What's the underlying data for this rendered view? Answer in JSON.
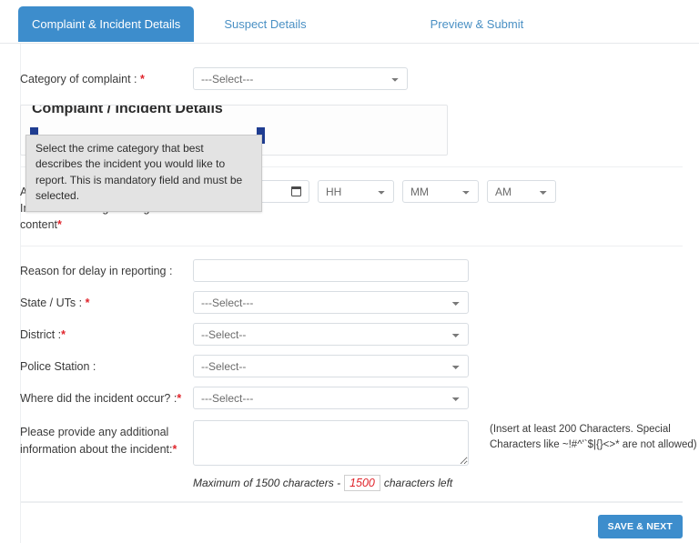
{
  "theme": {
    "accent": "#3d8dcc",
    "link": "#4a90c4",
    "required_star": "#e0242b",
    "counter_text": "#e0242b",
    "panel_chip": "#1f3d91",
    "tooltip_bg": "#e3e3e3"
  },
  "tabs": [
    {
      "label": "Complaint & Incident Details",
      "active": true
    },
    {
      "label": "Suspect Details",
      "active": false
    },
    {
      "label": "Preview & Submit",
      "active": false
    }
  ],
  "form": {
    "category": {
      "label": "Category of complaint : ",
      "required_mark": "*",
      "value": "---Select---"
    },
    "panel": {
      "title": "Complaint / Incident Details"
    },
    "tooltip": {
      "text": "Select the crime category that best describes the incident you would like to report. This is mandatory field and must be selected."
    },
    "datetime": {
      "label_line1": "Approximate date & time of",
      "label_line2": "Incident/receiving/viewing of",
      "label_line3": "content",
      "required_mark": "*",
      "date_placeholder": "dd/mm/yyyy",
      "date_value": "",
      "hour_value": "HH",
      "minute_value": "MM",
      "meridiem_value": "AM"
    },
    "reason_delay": {
      "label": "Reason for delay in reporting :",
      "value": "",
      "placeholder": ""
    },
    "state": {
      "label": "State / UTs : ",
      "required_mark": "*",
      "value": "---Select---"
    },
    "district": {
      "label": "District :",
      "required_mark": "*",
      "value": "--Select--"
    },
    "police_station": {
      "label": "Police Station :",
      "value": "--Select--"
    },
    "incident_location": {
      "label": "Where did the incident occur? :",
      "required_mark": "*",
      "value": "---Select---"
    },
    "additional_info": {
      "label_line1": "Please provide any additional",
      "label_line2": "information about the incident:",
      "required_mark": "*",
      "value": "",
      "hint": "(Insert at least 200 Characters. Special Characters like ~!#^'`$|{}<>* are not allowed)",
      "counter_prefix": "Maximum of 1500 characters -",
      "counter_value": "1500",
      "counter_suffix": "characters left"
    }
  },
  "footer": {
    "save_label": "SAVE & NEXT"
  }
}
